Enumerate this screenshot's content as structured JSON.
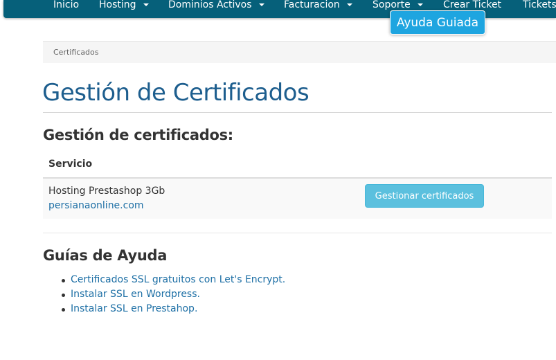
{
  "nav": {
    "items": [
      {
        "label": "Inicio",
        "dropdown": false
      },
      {
        "label": "Hosting",
        "dropdown": true
      },
      {
        "label": "Dominios Activos",
        "dropdown": true
      },
      {
        "label": "Facturacion",
        "dropdown": true
      },
      {
        "label": "Soporte",
        "dropdown": true
      },
      {
        "label": "Crear Ticket",
        "dropdown": false
      },
      {
        "label": "Tickets",
        "dropdown": false
      }
    ],
    "guided_help_label": "Ayuda Guiada"
  },
  "breadcrumb": {
    "current": "Certificados"
  },
  "page": {
    "title": "Gestión de Certificados"
  },
  "certificates": {
    "heading": "Gestión de certificados:",
    "column_header": "Servicio",
    "rows": [
      {
        "service": "Hosting Prestashop 3Gb",
        "domain": "persianaonline.com",
        "action_label": "Gestionar certificados"
      }
    ]
  },
  "help": {
    "heading": "Guías de Ayuda",
    "links": [
      "Certificados SSL gratuitos con Let's Encrypt.",
      "Instalar SSL en Wordpress.",
      "Instalar SSL en Prestahop."
    ]
  },
  "colors": {
    "nav_bg": "#06607a",
    "accent_blue": "#1ea5e0",
    "title_blue": "#1d5e8e",
    "link_blue": "#1d6fa5",
    "info_button": "#5bc0de"
  }
}
